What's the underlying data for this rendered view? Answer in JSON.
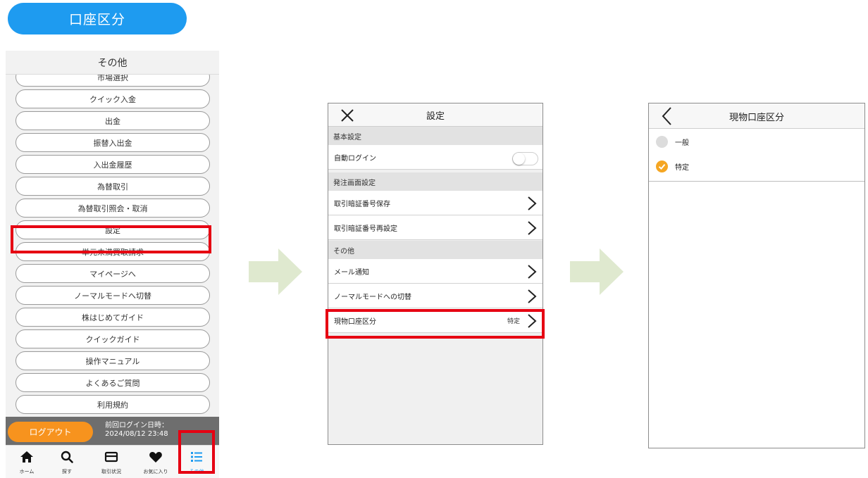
{
  "pill": {
    "label": "口座区分"
  },
  "panel1": {
    "header": "その他",
    "menu": [
      "市場選択",
      "クイック入金",
      "出金",
      "振替入出金",
      "入出金履歴",
      "為替取引",
      "為替取引照会・取消",
      "設定",
      "単元未満買取請求",
      "マイページへ",
      "ノーマルモードへ切替",
      "株はじめてガイド",
      "クイックガイド",
      "操作マニュアル",
      "よくあるご質問",
      "利用規約"
    ],
    "logout_label": "ログアウト",
    "last_login_label": "前回ログイン日時：",
    "last_login_value": "2024/08/12 23:48",
    "tabs": [
      {
        "label": "ホーム",
        "icon": "home-icon"
      },
      {
        "label": "探す",
        "icon": "search-icon"
      },
      {
        "label": "取引状況",
        "icon": "card-icon"
      },
      {
        "label": "お気に入り",
        "icon": "heart-icon"
      },
      {
        "label": "その他",
        "icon": "list-icon"
      }
    ],
    "accent_color": "#1e9bf0",
    "highlight_color": "#e60012"
  },
  "panel2": {
    "title": "設定",
    "sections": {
      "basic": "基本設定",
      "order": "発注画面設定",
      "other": "その他"
    },
    "rows": {
      "auto_login": "自動ログイン",
      "pin_save": "取引暗証番号保存",
      "pin_reset": "取引暗証番号再設定",
      "mail": "メール通知",
      "normal_mode": "ノーマルモードへの切替",
      "account_type": "現物口座区分",
      "account_type_value": "特定"
    }
  },
  "panel3": {
    "title": "現物口座区分",
    "options": [
      {
        "label": "一般",
        "selected": false
      },
      {
        "label": "特定",
        "selected": true
      }
    ]
  }
}
